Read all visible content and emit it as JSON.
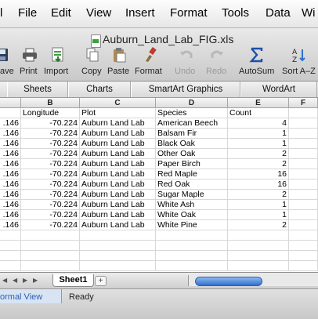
{
  "menu": [
    "l",
    "File",
    "Edit",
    "View",
    "Insert",
    "Format",
    "Tools",
    "Data",
    "Wi"
  ],
  "window": {
    "title": "Auburn_Land_Lab_FIG.xls"
  },
  "toolbar": {
    "save": "ave",
    "print": "Print",
    "import": "Import",
    "copy": "Copy",
    "paste": "Paste",
    "format": "Format",
    "undo": "Undo",
    "redo": "Redo",
    "autosum": "AutoSum",
    "sort": "Sort A–Z"
  },
  "ribbon": {
    "sheets": "Sheets",
    "charts": "Charts",
    "smartart": "SmartArt Graphics",
    "wordart": "WordArt"
  },
  "columns": [
    "B",
    "C",
    "D",
    "E",
    "F"
  ],
  "header_row": [
    "Longitude",
    "Plot",
    "Species",
    "Count"
  ],
  "rows": [
    {
      "a": ".146",
      "b": "-70.224",
      "c": "Auburn Land Lab",
      "d": "American Beech",
      "e": "4"
    },
    {
      "a": ".146",
      "b": "-70.224",
      "c": "Auburn Land Lab",
      "d": "Balsam Fir",
      "e": "1"
    },
    {
      "a": ".146",
      "b": "-70.224",
      "c": "Auburn Land Lab",
      "d": "Black Oak",
      "e": "1"
    },
    {
      "a": ".146",
      "b": "-70.224",
      "c": "Auburn Land Lab",
      "d": "Other Oak",
      "e": "2"
    },
    {
      "a": ".146",
      "b": "-70.224",
      "c": "Auburn Land Lab",
      "d": "Paper Birch",
      "e": "2"
    },
    {
      "a": ".146",
      "b": "-70.224",
      "c": "Auburn Land Lab",
      "d": "Red Maple",
      "e": "16"
    },
    {
      "a": ".146",
      "b": "-70.224",
      "c": "Auburn Land Lab",
      "d": "Red Oak",
      "e": "16"
    },
    {
      "a": ".146",
      "b": "-70.224",
      "c": "Auburn Land Lab",
      "d": "Sugar Maple",
      "e": "2"
    },
    {
      "a": ".146",
      "b": "-70.224",
      "c": "Auburn Land Lab",
      "d": "White Ash",
      "e": "1"
    },
    {
      "a": ".146",
      "b": "-70.224",
      "c": "Auburn Land Lab",
      "d": "White Oak",
      "e": "1"
    },
    {
      "a": ".146",
      "b": "-70.224",
      "c": "Auburn Land Lab",
      "d": "White Pine",
      "e": "2"
    }
  ],
  "sheet_tab": "Sheet1",
  "add_sheet": "+",
  "status": {
    "view": "ormal View",
    "text": "Ready"
  }
}
